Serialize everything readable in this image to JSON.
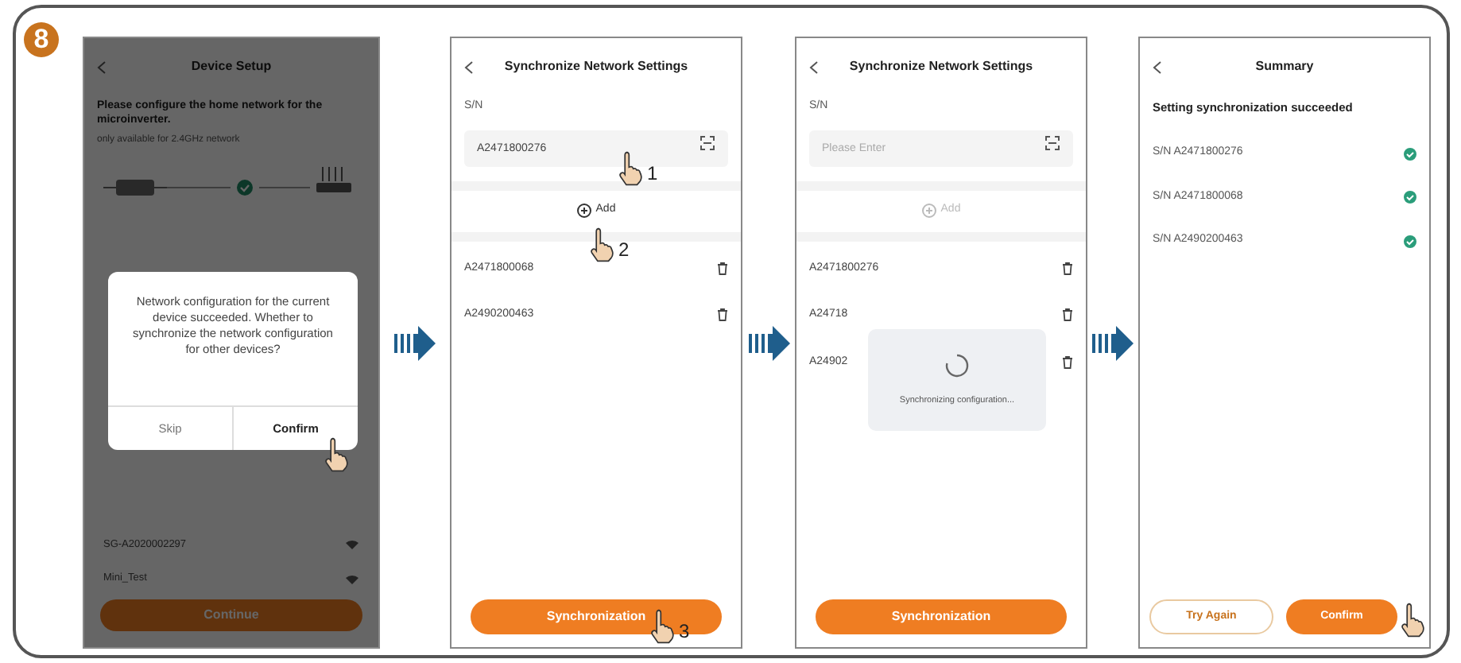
{
  "step": "8",
  "screens": [
    {
      "kind": "device_setup",
      "title": "Device Setup",
      "heading": "Please configure the home network for the microinverter.",
      "note": "only available for 2.4GHz network",
      "networks": [
        "SG-A2020002297",
        "Mini_Test"
      ],
      "button": "Continue",
      "dialog": {
        "message": "Network configuration for the current device succeeded. Whether to synchronize the network configuration for other devices?",
        "buttons": [
          {
            "label": "Skip",
            "primary": false,
            "hand": false
          },
          {
            "label": "Confirm",
            "primary": true,
            "hand": true
          }
        ]
      }
    },
    {
      "kind": "sync",
      "title": "Synchronize Network Settings",
      "field_label": "S/N",
      "field": {
        "value": "A2471800276",
        "hand": true,
        "hand_number": "1"
      },
      "add": {
        "label": "Add",
        "disabled": false,
        "hand": true,
        "hand_number": "2"
      },
      "devices": [
        "A2471800068",
        "A2490200463"
      ],
      "button": {
        "label": "Synchronization",
        "hand": true,
        "hand_number": "3"
      }
    },
    {
      "kind": "sync",
      "title": "Synchronize Network Settings",
      "field_label": "S/N",
      "field": {
        "placeholder": "Please Enter",
        "hand": false
      },
      "add": {
        "label": "Add",
        "disabled": true,
        "hand": false
      },
      "devices": [
        "A2471800276",
        "A24718",
        "A24902"
      ],
      "button": {
        "label": "Synchronization",
        "hand": false
      },
      "loading": "Synchronizing configuration..."
    },
    {
      "kind": "summary",
      "title": "Summary",
      "heading": "Setting synchronization succeeded",
      "results": [
        {
          "label": "S/N A2471800276",
          "ok": true
        },
        {
          "label": "S/N A2471800068",
          "ok": true
        },
        {
          "label": "S/N A2490200463",
          "ok": true
        }
      ],
      "buttons": [
        {
          "label": "Try Again",
          "primary": false,
          "hand": false
        },
        {
          "label": "Confirm",
          "primary": true,
          "hand": true
        }
      ]
    }
  ]
}
